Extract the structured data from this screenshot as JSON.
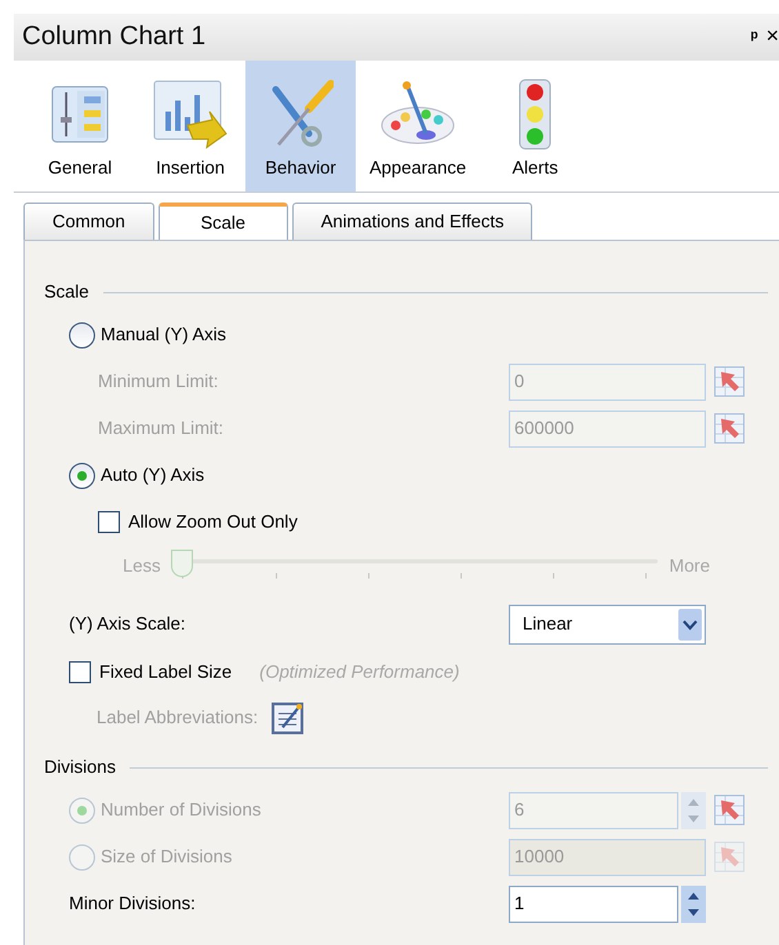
{
  "window": {
    "title": "Column Chart 1",
    "pin": "ᵖ",
    "close": "×"
  },
  "categories": [
    {
      "label": "General",
      "kind": "general",
      "selected": false
    },
    {
      "label": "Insertion",
      "kind": "insertion",
      "selected": false
    },
    {
      "label": "Behavior",
      "kind": "behavior",
      "selected": true
    },
    {
      "label": "Appearance",
      "kind": "appearance",
      "selected": false
    },
    {
      "label": "Alerts",
      "kind": "alerts",
      "selected": false
    }
  ],
  "tabs": [
    {
      "label": "Common",
      "selected": false
    },
    {
      "label": "Scale",
      "selected": true
    },
    {
      "label": "Animations and Effects",
      "selected": false
    }
  ],
  "sections": [
    {
      "title": "Scale",
      "rows": [
        {
          "kind": "radio",
          "label": "Manual (Y) Axis",
          "selected": false,
          "disabled": false,
          "children": [
            {
              "kind": "field",
              "label": "Minimum Limit:",
              "value": "0",
              "disabled": true,
              "picker": true
            },
            {
              "kind": "field",
              "label": "Maximum Limit:",
              "value": "600000",
              "disabled": true,
              "picker": true
            }
          ]
        },
        {
          "kind": "radio",
          "label": "Auto (Y) Axis",
          "selected": true,
          "disabled": false,
          "children": [
            {
              "kind": "checkbox",
              "label": "Allow Zoom Out Only",
              "checked": false,
              "children": [
                {
                  "kind": "slider",
                  "min_label": "Less",
                  "max_label": "More",
                  "level": 0,
                  "disabled": true
                }
              ]
            }
          ]
        },
        {
          "kind": "dropdown",
          "label": "(Y) Axis Scale:",
          "value": "Linear"
        },
        {
          "kind": "checkbox",
          "label": "Fixed Label Size",
          "checked": false,
          "note": "(Optimized Performance)",
          "children": [
            {
              "kind": "editor",
              "label": "Label Abbreviations:",
              "disabled": true
            }
          ]
        }
      ]
    },
    {
      "title": "Divisions",
      "rows": [
        {
          "kind": "radio",
          "label": "Number of Divisions",
          "selected": true,
          "disabled": true,
          "field": {
            "value": "6",
            "spin": true,
            "disabled": true,
            "picker": true,
            "picker_disabled": false
          }
        },
        {
          "kind": "radio",
          "label": "Size of Divisions",
          "selected": false,
          "disabled": true,
          "field": {
            "value": "10000",
            "disabled": true,
            "picker": true,
            "picker_disabled": true
          }
        },
        {
          "kind": "label",
          "label": "Minor Divisions:",
          "field": {
            "value": "1",
            "spin": true,
            "disabled": false
          }
        }
      ]
    }
  ]
}
